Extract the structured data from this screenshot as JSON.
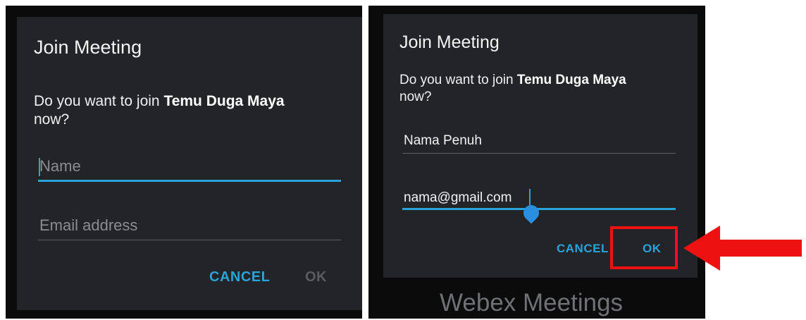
{
  "left": {
    "title": "Join Meeting",
    "message_prefix": "Do you want to join ",
    "meeting_name": "Temu Duga Maya",
    "message_suffix": "now?",
    "name_placeholder": "Name",
    "email_placeholder": "Email address",
    "cancel_label": "CANCEL",
    "ok_label": "OK"
  },
  "right": {
    "title": "Join Meeting",
    "message_prefix": "Do you want to join ",
    "meeting_name": "Temu Duga Maya",
    "message_suffix": "now?",
    "name_value": "Nama Penuh",
    "email_value": "nama@gmail.com",
    "cancel_label": "CANCEL",
    "ok_label": "OK",
    "brand_text": "Webex Meetings"
  },
  "colors": {
    "accent": "#29a3d8",
    "highlight": "#ee1111",
    "dialog_bg": "#232427"
  },
  "icons": {
    "arrow": "red-arrow-left-icon",
    "text_handle": "text-selection-handle-icon"
  }
}
